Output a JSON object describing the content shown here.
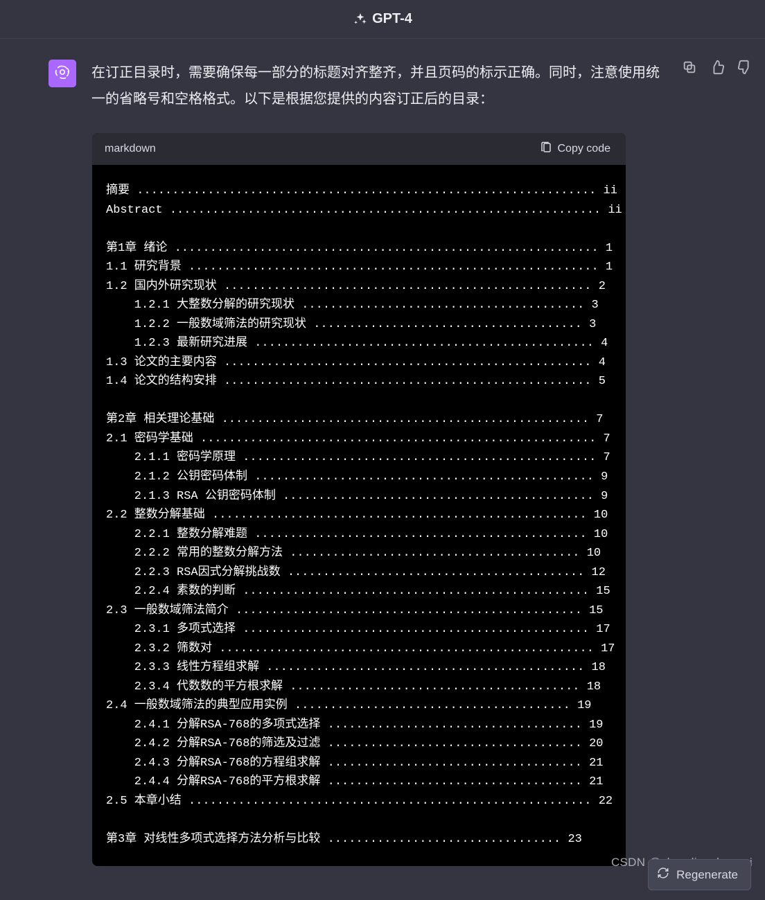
{
  "header": {
    "title": "GPT-4"
  },
  "actions": {
    "regenerate": "Regenerate"
  },
  "message": {
    "text": "在订正目录时，需要确保每一部分的标题对齐整齐，并且页码的标示正确。同时，注意使用统一的省略号和空格格式。以下是根据您提供的内容订正后的目录："
  },
  "codeblock": {
    "language": "markdown",
    "copy_label": "Copy code",
    "toc": [
      {
        "indent": 0,
        "title": "摘要",
        "page": "ii"
      },
      {
        "indent": 0,
        "title": "Abstract",
        "page": "ii"
      },
      {
        "blank": true
      },
      {
        "indent": 0,
        "title": "第1章 绪论",
        "page": "1"
      },
      {
        "indent": 0,
        "title": "1.1 研究背景",
        "page": "1"
      },
      {
        "indent": 0,
        "title": "1.2 国内外研究现状",
        "page": "2"
      },
      {
        "indent": 1,
        "title": "1.2.1 大整数分解的研究现状",
        "page": "3"
      },
      {
        "indent": 1,
        "title": "1.2.2 一般数域筛法的研究现状",
        "page": "3"
      },
      {
        "indent": 1,
        "title": "1.2.3 最新研究进展",
        "page": "4"
      },
      {
        "indent": 0,
        "title": "1.3 论文的主要内容",
        "page": "4"
      },
      {
        "indent": 0,
        "title": "1.4 论文的结构安排",
        "page": "5"
      },
      {
        "blank": true
      },
      {
        "indent": 0,
        "title": "第2章 相关理论基础",
        "page": "7"
      },
      {
        "indent": 0,
        "title": "2.1 密码学基础",
        "page": "7"
      },
      {
        "indent": 1,
        "title": "2.1.1 密码学原理",
        "page": "7"
      },
      {
        "indent": 1,
        "title": "2.1.2 公钥密码体制",
        "page": "9"
      },
      {
        "indent": 1,
        "title": "2.1.3 RSA 公钥密码体制",
        "page": "9"
      },
      {
        "indent": 0,
        "title": "2.2 整数分解基础",
        "page": "10"
      },
      {
        "indent": 1,
        "title": "2.2.1 整数分解难题",
        "page": "10"
      },
      {
        "indent": 1,
        "title": "2.2.2 常用的整数分解方法",
        "page": "10"
      },
      {
        "indent": 1,
        "title": "2.2.3 RSA因式分解挑战数",
        "page": "12"
      },
      {
        "indent": 1,
        "title": "2.2.4 素数的判断",
        "page": "15"
      },
      {
        "indent": 0,
        "title": "2.3 一般数域筛法简介",
        "page": "15"
      },
      {
        "indent": 1,
        "title": "2.3.1 多项式选择",
        "page": "17"
      },
      {
        "indent": 1,
        "title": "2.3.2 筛数对",
        "page": "17"
      },
      {
        "indent": 1,
        "title": "2.3.3 线性方程组求解",
        "page": "18"
      },
      {
        "indent": 1,
        "title": "2.3.4 代数数的平方根求解",
        "page": "18"
      },
      {
        "indent": 0,
        "title": "2.4 一般数域筛法的典型应用实例",
        "page": "19"
      },
      {
        "indent": 1,
        "title": "2.4.1 分解RSA-768的多项式选择",
        "page": "19"
      },
      {
        "indent": 1,
        "title": "2.4.2 分解RSA-768的筛选及过滤",
        "page": "20"
      },
      {
        "indent": 1,
        "title": "2.4.3 分解RSA-768的方程组求解",
        "page": "21"
      },
      {
        "indent": 1,
        "title": "2.4.4 分解RSA-768的平方根求解",
        "page": "21"
      },
      {
        "indent": 0,
        "title": "2.5 本章小结",
        "page": "22"
      },
      {
        "blank": true
      },
      {
        "indent": 0,
        "title": "第3章 对线性多项式选择方法分析与比较",
        "page": "23"
      }
    ]
  },
  "watermark": "CSDN @shandianchengzi"
}
